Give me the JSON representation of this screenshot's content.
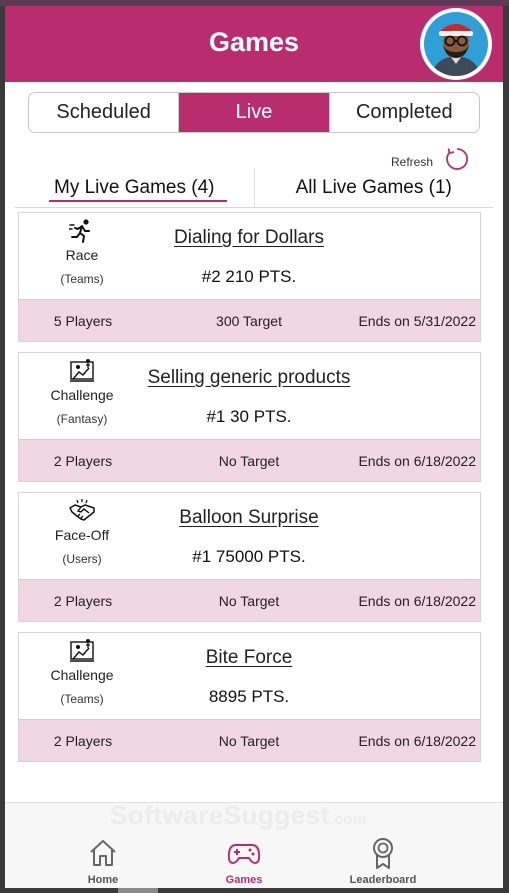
{
  "header": {
    "title": "Games"
  },
  "status_tabs": [
    {
      "label": "Scheduled",
      "active": false
    },
    {
      "label": "Live",
      "active": true
    },
    {
      "label": "Completed",
      "active": false
    }
  ],
  "refresh": {
    "label": "Refresh",
    "icon": "refresh-icon"
  },
  "sub_tabs": [
    {
      "label": "My Live Games (4)",
      "active": true
    },
    {
      "label": "All Live Games (1)",
      "active": false
    }
  ],
  "games": [
    {
      "type": "Race",
      "subtype": "(Teams)",
      "icon": "runner-icon",
      "name": "Dialing for Dollars",
      "score": "#2  210 PTS.",
      "players": "5 Players",
      "target": "300 Target",
      "ends": "Ends on 5/31/2022"
    },
    {
      "type": "Challenge",
      "subtype": "(Fantasy)",
      "icon": "challenge-icon",
      "name": "Selling generic products",
      "score": "#1  30 PTS.",
      "players": "2 Players",
      "target": "No Target",
      "ends": "Ends on 6/18/2022"
    },
    {
      "type": "Face-Off",
      "subtype": "(Users)",
      "icon": "handshake-icon",
      "name": "Balloon Surprise",
      "score": "#1  75000 PTS.",
      "players": "2 Players",
      "target": "No Target",
      "ends": "Ends on 6/18/2022"
    },
    {
      "type": "Challenge",
      "subtype": "(Teams)",
      "icon": "challenge-icon",
      "name": "Bite Force",
      "score": "8895 PTS.",
      "players": "2 Players",
      "target": "No Target",
      "ends": "Ends on 6/18/2022"
    }
  ],
  "watermark": {
    "text": "SoftwareSuggest",
    "suffix": ".com"
  },
  "bottom_nav": [
    {
      "label": "Home",
      "icon": "home-icon",
      "active": false
    },
    {
      "label": "Games",
      "icon": "gamepad-icon",
      "active": true
    },
    {
      "label": "Leaderboard",
      "icon": "award-icon",
      "active": false
    }
  ],
  "colors": {
    "accent": "#b92d6f",
    "card_footer": "#f1d7e2"
  }
}
